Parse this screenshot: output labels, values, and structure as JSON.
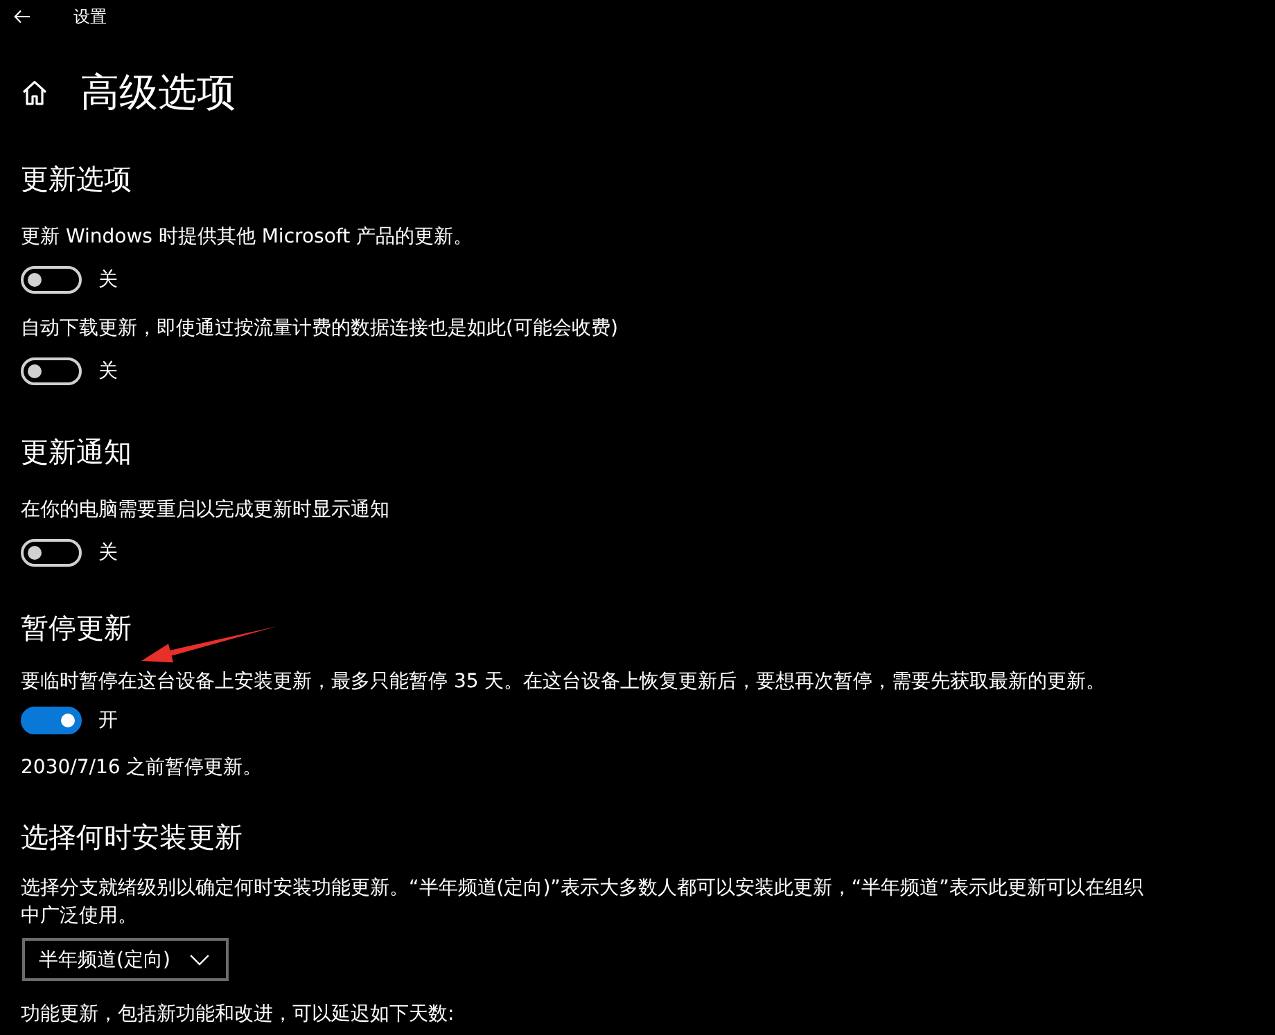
{
  "top_bar": {
    "title": "设置"
  },
  "page": {
    "title": "高级选项"
  },
  "sections": [
    {
      "heading": "更新选项",
      "items": [
        {
          "kind": "toggle",
          "label": "更新 Windows 时提供其他 Microsoft 产品的更新。",
          "on": false,
          "state_text": "关"
        },
        {
          "kind": "toggle",
          "label": "自动下载更新，即使通过按流量计费的数据连接也是如此(可能会收费)",
          "on": false,
          "state_text": "关"
        }
      ]
    },
    {
      "heading": "更新通知",
      "items": [
        {
          "kind": "toggle",
          "label": "在你的电脑需要重启以完成更新时显示通知",
          "on": false,
          "state_text": "关"
        }
      ]
    },
    {
      "heading": "暂停更新",
      "items": [
        {
          "kind": "toggle",
          "label": "要临时暂停在这台设备上安装更新，最多只能暂停 35 天。在这台设备上恢复更新后，要想再次暂停，需要先获取最新的更新。",
          "on": true,
          "state_text": "开"
        },
        {
          "kind": "note",
          "text": "2030/7/16 之前暂停更新。"
        }
      ]
    },
    {
      "heading": "选择何时安装更新",
      "items": [
        {
          "kind": "paragraph",
          "text": "选择分支就绪级别以确定何时安装功能更新。“半年频道(定向)”表示大多数人都可以安装此更新，“半年频道”表示此更新可以在组织中广泛使用。"
        },
        {
          "kind": "dropdown",
          "value": "半年频道(定向)"
        },
        {
          "kind": "note",
          "text": "功能更新，包括新功能和改进，可以延迟如下天数:"
        }
      ]
    }
  ]
}
